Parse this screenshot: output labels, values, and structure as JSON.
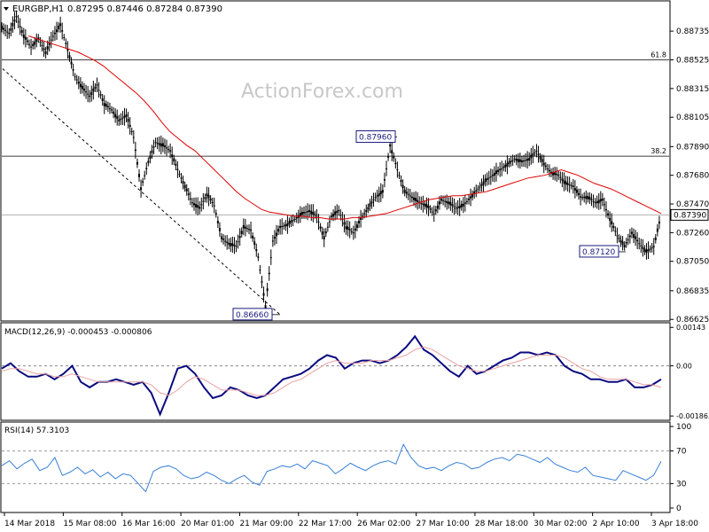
{
  "header": {
    "symbol_label": "EURGBP,H1",
    "ohlc": "0.87295 0.87446 0.87284 0.87390"
  },
  "watermark": "ActionForex.com",
  "colors": {
    "candle": "#000000",
    "ma": "#e00000",
    "line": "#000000",
    "macd": "#0a0a80",
    "signal": "#e8a0a0",
    "rsi": "#3a80d8"
  },
  "chart_data": [
    {
      "type": "candlestick",
      "title": "EURGBP,H1",
      "ylim": [
        0.8662,
        0.8895
      ],
      "y_ticks": [
        "0.88735",
        "0.88525",
        "0.88315",
        "0.88105",
        "0.87890",
        "0.87680",
        "0.87470",
        "0.87260",
        "0.87050",
        "0.86835",
        "0.86625"
      ],
      "y_tick_values": [
        0.88735,
        0.88525,
        0.88315,
        0.88105,
        0.8789,
        0.8768,
        0.8747,
        0.8726,
        0.8705,
        0.86835,
        0.86625
      ],
      "x_ticks": [
        "14 Mar 2018",
        "15 Mar 08:00",
        "16 Mar 16:00",
        "20 Mar 01:00",
        "21 Mar 09:00",
        "22 Mar 17:00",
        "26 Mar 02:00",
        "27 Mar 10:00",
        "28 Mar 18:00",
        "30 Mar 02:00",
        "2 Apr 10:00",
        "3 Apr 18:00"
      ],
      "last_price": 0.8739,
      "last_price_label": "0.87390",
      "fib_levels": [
        {
          "label": "61.8",
          "value": 0.88525
        },
        {
          "label": "38.2",
          "value": 0.8782
        }
      ],
      "annotations": [
        {
          "label": "0.87960",
          "value": 0.8796
        },
        {
          "label": "0.87120",
          "value": 0.8712
        },
        {
          "label": "0.86660",
          "value": 0.8666
        }
      ],
      "trendline": [
        {
          "value": 0.8846
        },
        {
          "value": 0.8666
        }
      ],
      "price_path": [
        0.8876,
        0.8872,
        0.8884,
        0.887,
        0.8862,
        0.8868,
        0.8858,
        0.887,
        0.8878,
        0.886,
        0.884,
        0.8832,
        0.8826,
        0.8834,
        0.882,
        0.8816,
        0.8808,
        0.8812,
        0.8796,
        0.8758,
        0.8778,
        0.8792,
        0.879,
        0.8786,
        0.8772,
        0.876,
        0.8748,
        0.8744,
        0.8754,
        0.8746,
        0.8722,
        0.8718,
        0.8716,
        0.873,
        0.8728,
        0.8708,
        0.8672,
        0.872,
        0.873,
        0.8732,
        0.8736,
        0.874,
        0.8742,
        0.8738,
        0.8722,
        0.8738,
        0.8742,
        0.873,
        0.8726,
        0.8736,
        0.8744,
        0.8752,
        0.8756,
        0.879,
        0.8772,
        0.8756,
        0.8752,
        0.8748,
        0.8746,
        0.874,
        0.875,
        0.8748,
        0.8744,
        0.8746,
        0.8752,
        0.8758,
        0.8764,
        0.8768,
        0.8772,
        0.8776,
        0.878,
        0.8778,
        0.878,
        0.8786,
        0.8776,
        0.877,
        0.8768,
        0.8762,
        0.876,
        0.8752,
        0.8752,
        0.8748,
        0.875,
        0.8736,
        0.8724,
        0.8716,
        0.8726,
        0.8718,
        0.8712,
        0.8716,
        0.8739
      ],
      "ma_path": [
        0.887,
        0.8868,
        0.8866,
        0.8864,
        0.8862,
        0.886,
        0.8858,
        0.8855,
        0.8852,
        0.8848,
        0.8843,
        0.8838,
        0.8833,
        0.8828,
        0.8822,
        0.8815,
        0.8807,
        0.88,
        0.8795,
        0.879,
        0.8786,
        0.878,
        0.8774,
        0.8768,
        0.8762,
        0.8756,
        0.8751,
        0.8747,
        0.8743,
        0.8741,
        0.874,
        0.8739,
        0.8738,
        0.8738,
        0.8737,
        0.8737,
        0.8736,
        0.8736,
        0.8736,
        0.8737,
        0.8737,
        0.8738,
        0.8739,
        0.874,
        0.8742,
        0.8744,
        0.8746,
        0.8748,
        0.875,
        0.8751,
        0.8752,
        0.8753,
        0.8753,
        0.8754,
        0.8755,
        0.8756,
        0.8758,
        0.876,
        0.8762,
        0.8764,
        0.8766,
        0.8767,
        0.8768,
        0.877,
        0.8772,
        0.877,
        0.8768,
        0.8765,
        0.8762,
        0.876,
        0.8758,
        0.8755,
        0.8752,
        0.8749,
        0.8746,
        0.8743,
        0.874
      ]
    },
    {
      "type": "line",
      "title": "MACD(12,26,9) -0.000453 -0.000806",
      "ylim": [
        -0.00199,
        0.00157
      ],
      "y_ticks": [
        "0.00143",
        "0.00",
        "-0.001863"
      ],
      "y_tick_values": [
        0.00143,
        0.0,
        -0.001863
      ],
      "zero_level": 0.0,
      "series": [
        {
          "values": [
            -0.0001,
            0.0001,
            -0.0002,
            -0.0004,
            -0.0004,
            -0.0003,
            -0.0005,
            -0.0003,
            0.0,
            -0.0006,
            -0.0008,
            -0.0006,
            -0.0006,
            -0.0005,
            -0.0006,
            -0.0007,
            -0.0006,
            -0.001,
            -0.0018,
            -0.001,
            -0.0001,
            0.0,
            -0.0003,
            -0.0008,
            -0.0012,
            -0.0011,
            -0.0008,
            -0.0009,
            -0.0011,
            -0.0012,
            -0.0011,
            -0.0008,
            -0.0005,
            -0.0004,
            -0.0003,
            -0.0001,
            0.0002,
            0.0004,
            0.0003,
            -0.0001,
            0.0001,
            0.0002,
            0.0002,
            0.0001,
            0.0002,
            0.0004,
            0.0007,
            0.0011,
            0.0006,
            0.0004,
            0.0001,
            -0.0002,
            -0.0004,
            0.0,
            -0.0003,
            -0.0002,
            0.0,
            0.0002,
            0.0003,
            0.0005,
            0.0005,
            0.0004,
            0.0005,
            0.0004,
            0.0,
            -0.0002,
            -0.0003,
            -0.0005,
            -0.0005,
            -0.0006,
            -0.0006,
            -0.0005,
            -0.0008,
            -0.0008,
            -0.0007,
            -0.0005
          ]
        },
        {
          "values": [
            -0.0002,
            -0.0001,
            -0.0001,
            -0.0002,
            -0.0003,
            -0.0003,
            -0.0004,
            -0.0004,
            -0.0003,
            -0.0004,
            -0.0005,
            -0.0006,
            -0.0006,
            -0.0006,
            -0.0006,
            -0.0006,
            -0.0006,
            -0.0007,
            -0.001,
            -0.0011,
            -0.0009,
            -0.0006,
            -0.0004,
            -0.0005,
            -0.0007,
            -0.0009,
            -0.0009,
            -0.0009,
            -0.001,
            -0.0011,
            -0.0011,
            -0.001,
            -0.0008,
            -0.0006,
            -0.0005,
            -0.0003,
            -0.0001,
            0.0001,
            0.0002,
            0.0001,
            0.0001,
            0.0001,
            0.0002,
            0.0002,
            0.0002,
            0.0003,
            0.0004,
            0.0006,
            0.0007,
            0.0006,
            0.0004,
            0.0002,
            0.0,
            -0.0001,
            -0.0002,
            -0.0002,
            -0.0001,
            0.0,
            0.0001,
            0.0002,
            0.0003,
            0.0004,
            0.0004,
            0.0004,
            0.0003,
            0.0001,
            -0.0001,
            -0.0002,
            -0.0004,
            -0.0005,
            -0.0005,
            -0.0005,
            -0.0006,
            -0.0007,
            -0.0007,
            -0.0008
          ]
        }
      ]
    },
    {
      "type": "line",
      "title": "RSI(14) 57.3103",
      "ylim": [
        0,
        100
      ],
      "y_ticks": [
        "100",
        "70",
        "30",
        "0"
      ],
      "y_tick_values": [
        100,
        70,
        30,
        0
      ],
      "levels": [
        70,
        30
      ],
      "series": [
        {
          "values": [
            52,
            58,
            48,
            55,
            60,
            46,
            50,
            62,
            40,
            44,
            50,
            42,
            47,
            38,
            44,
            36,
            42,
            40,
            30,
            20,
            45,
            50,
            52,
            48,
            40,
            36,
            38,
            44,
            40,
            34,
            30,
            36,
            40,
            32,
            28,
            45,
            48,
            52,
            50,
            54,
            48,
            58,
            55,
            52,
            42,
            48,
            55,
            50,
            46,
            52,
            56,
            58,
            54,
            78,
            62,
            52,
            48,
            50,
            46,
            52,
            56,
            54,
            48,
            50,
            56,
            60,
            62,
            58,
            66,
            64,
            60,
            56,
            62,
            54,
            50,
            46,
            44,
            50,
            40,
            38,
            36,
            34,
            46,
            42,
            38,
            34,
            40,
            57.3103
          ]
        }
      ]
    }
  ]
}
